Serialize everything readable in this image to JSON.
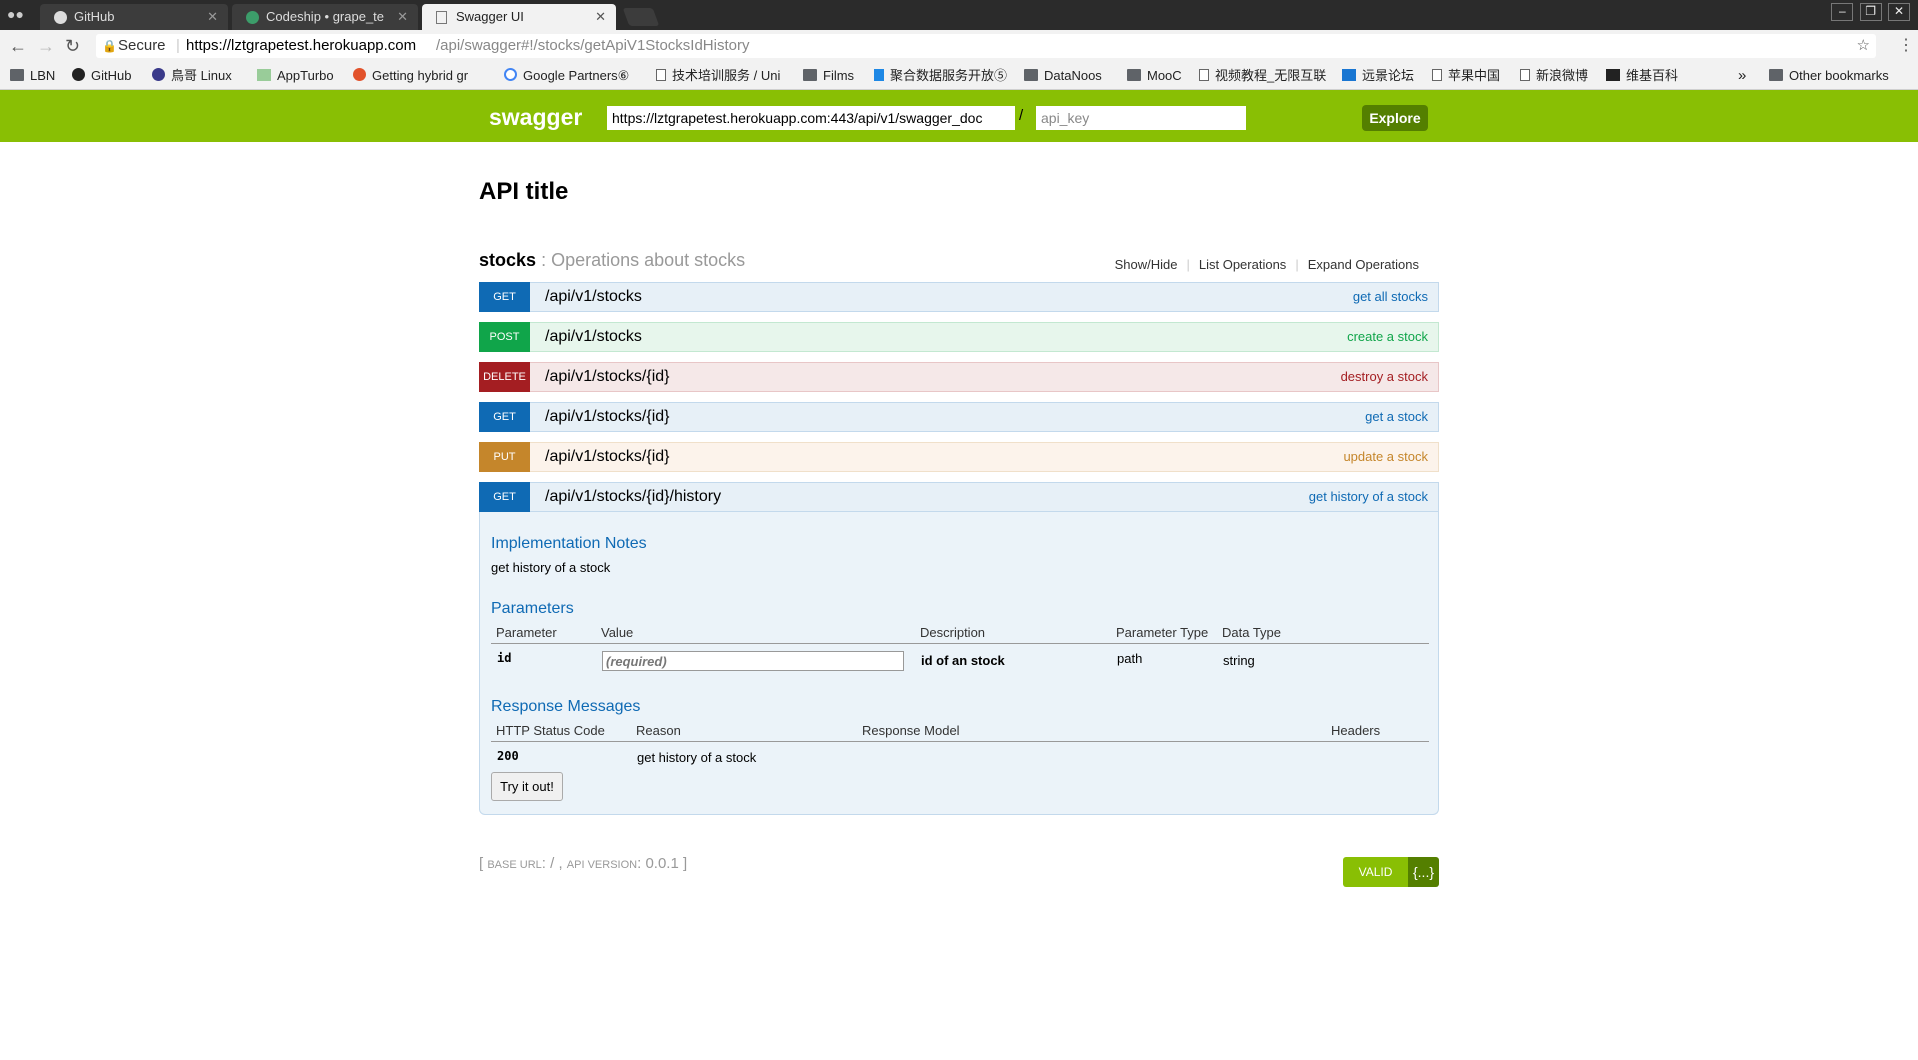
{
  "browser": {
    "tabs": [
      {
        "title": "GitHub",
        "active": false
      },
      {
        "title": "Codeship • grape_te",
        "active": false
      },
      {
        "title": "Swagger UI",
        "active": true
      }
    ],
    "address": {
      "secure_label": "Secure",
      "url_host": "https://lztgrapetest.herokuapp.com",
      "url_path": "/api/swagger#!/stocks/getApiV1StocksIdHistory"
    },
    "bookmarks": [
      {
        "label": "LBN",
        "icon": "folder-icon"
      },
      {
        "label": "GitHub",
        "icon": "github-icon"
      },
      {
        "label": "鳥哥 Linux",
        "icon": "site-icon"
      },
      {
        "label": "AppTurbo",
        "icon": "site-icon"
      },
      {
        "label": "Getting hybrid gr",
        "icon": "site-icon"
      },
      {
        "label": "Google Partners⑥",
        "icon": "google-icon"
      },
      {
        "label": "技术培训服务 / Uni",
        "icon": "page-icon"
      },
      {
        "label": "Films",
        "icon": "folder-icon"
      },
      {
        "label": "聚合数据服务开放⑤",
        "icon": "site-icon"
      },
      {
        "label": "DataNoos",
        "icon": "folder-icon"
      },
      {
        "label": "MooC",
        "icon": "folder-icon"
      },
      {
        "label": "视频教程_无限互联",
        "icon": "page-icon"
      },
      {
        "label": "远景论坛",
        "icon": "site-icon"
      },
      {
        "label": "苹果中国",
        "icon": "page-icon"
      },
      {
        "label": "新浪微博",
        "icon": "page-icon"
      },
      {
        "label": "维基百科",
        "icon": "wikipedia-icon"
      }
    ],
    "bookmarks_overflow": "»",
    "other_bookmarks": "Other bookmarks"
  },
  "swagger_header": {
    "logo": "swagger",
    "url_value": "https://lztgrapetest.herokuapp.com:443/api/v1/swagger_doc",
    "slash": "/",
    "api_key_placeholder": "api_key",
    "explore_label": "Explore"
  },
  "api_title": "API title",
  "resource": {
    "name": "stocks",
    "description": ": Operations about stocks",
    "links": [
      "Show/Hide",
      "List Operations",
      "Expand Operations"
    ]
  },
  "operations": [
    {
      "method": "GET",
      "path": "/api/v1/stocks",
      "summary": "get all stocks"
    },
    {
      "method": "POST",
      "path": "/api/v1/stocks",
      "summary": "create a stock"
    },
    {
      "method": "DELETE",
      "path": "/api/v1/stocks/{id}",
      "summary": "destroy a stock"
    },
    {
      "method": "GET",
      "path": "/api/v1/stocks/{id}",
      "summary": "get a stock"
    },
    {
      "method": "PUT",
      "path": "/api/v1/stocks/{id}",
      "summary": "update a stock"
    },
    {
      "method": "GET",
      "path": "/api/v1/stocks/{id}/history",
      "summary": "get history of a stock"
    }
  ],
  "expanded": {
    "impl_title": "Implementation Notes",
    "impl_text": "get history of a stock",
    "params_title": "Parameters",
    "params_headers": [
      "Parameter",
      "Value",
      "Description",
      "Parameter Type",
      "Data Type"
    ],
    "param": {
      "name": "id",
      "placeholder": "(required)",
      "description": "id of an stock",
      "type": "path",
      "data_type": "string"
    },
    "responses_title": "Response Messages",
    "responses_headers": [
      "HTTP Status Code",
      "Reason",
      "Response Model",
      "Headers"
    ],
    "response": {
      "code": "200",
      "reason": "get history of a stock"
    },
    "try_label": "Try it out!"
  },
  "footer": {
    "base_url_label": "base url",
    "base_url_value": "/",
    "api_version_label": "api version",
    "api_version_value": "0.0.1"
  },
  "validator": {
    "label": "VALID",
    "icon": "{...}"
  }
}
